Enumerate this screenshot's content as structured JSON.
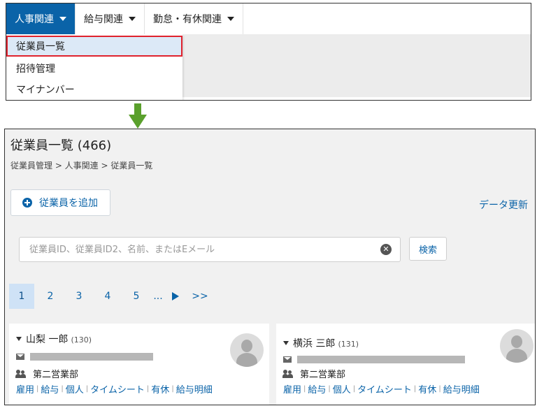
{
  "nav": {
    "items": [
      {
        "label": "人事関連",
        "active": true
      },
      {
        "label": "給与関連",
        "active": false
      },
      {
        "label": "勤怠・有休関連",
        "active": false
      }
    ],
    "dropdown": [
      "従業員一覧",
      "招待管理",
      "マイナンバー"
    ],
    "selected_index": 0
  },
  "page": {
    "title": "従業員一覧 (466)",
    "breadcrumb": "従業員管理 > 人事関連 > 従業員一覧",
    "add_button": "従業員を追加",
    "refresh_link": "データ更新"
  },
  "search": {
    "placeholder": "従業員ID、従業員ID2、名前、またはEメール",
    "value": "",
    "button": "検索"
  },
  "pagination": {
    "pages": [
      "1",
      "2",
      "3",
      "4",
      "5"
    ],
    "current": "1",
    "ellipsis": "...",
    "last": ">>"
  },
  "employees": [
    {
      "name": "山梨 一郎",
      "id": "(130)",
      "department": "第二営業部",
      "links": [
        "雇用",
        "給与",
        "個人",
        "タイムシート",
        "有休",
        "給与明細"
      ]
    },
    {
      "name": "横浜 三郎",
      "id": "(131)",
      "department": "第二営業部",
      "links": [
        "雇用",
        "給与",
        "個人",
        "タイムシート",
        "有休",
        "給与明細"
      ]
    }
  ],
  "colors": {
    "primary": "#0a63a8",
    "highlight_border": "#e0222d",
    "arrow": "#5aa02c"
  }
}
